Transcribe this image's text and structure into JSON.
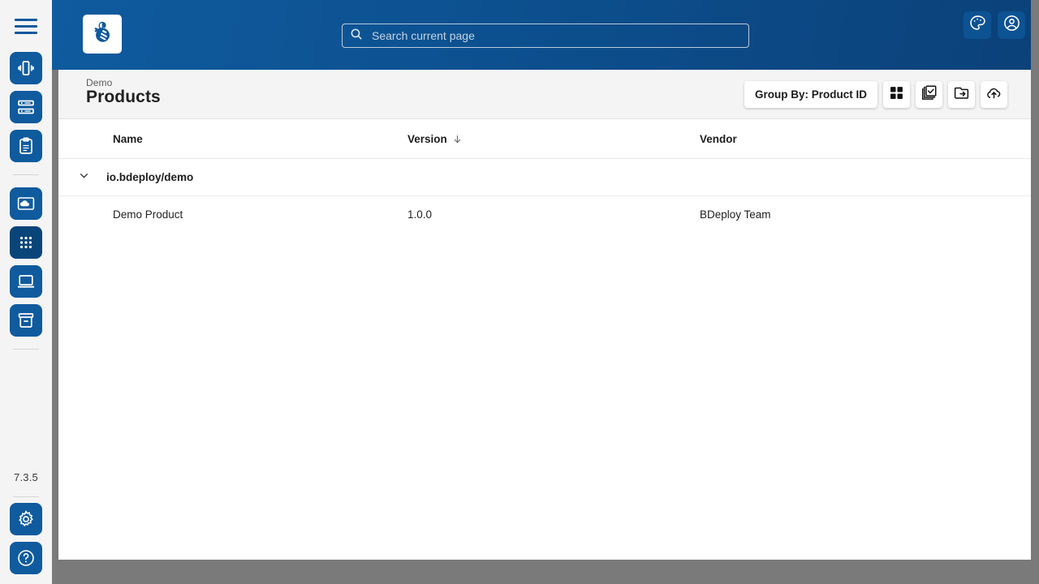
{
  "app": {
    "version": "7.3.5",
    "logo_icon": "bdeploy-bee-logo"
  },
  "menu": {
    "hamburger_icon": "hamburger-menu-icon"
  },
  "search": {
    "icon": "search-icon",
    "value": "",
    "placeholder": "Search current page"
  },
  "top_actions": [
    {
      "name": "theme-button",
      "icon": "palette-icon"
    },
    {
      "name": "account-button",
      "icon": "account-circle-icon"
    }
  ],
  "sidebar": {
    "items": [
      {
        "name": "instance-groups",
        "icon": "instances-icon",
        "active": false
      },
      {
        "name": "instances",
        "icon": "list-icon",
        "active": false
      },
      {
        "name": "reports",
        "icon": "clipboard-icon",
        "active": false
      },
      {
        "name": "software-repositories",
        "icon": "cloud-image-icon",
        "active": false
      },
      {
        "name": "products",
        "icon": "apps-grid-icon",
        "active": true
      },
      {
        "name": "client-applications",
        "icon": "laptop-icon",
        "active": false
      },
      {
        "name": "system-templates",
        "icon": "archive-icon",
        "active": false
      }
    ],
    "bottom_items": [
      {
        "name": "settings",
        "icon": "gear-icon"
      },
      {
        "name": "help",
        "icon": "help-circle-icon"
      }
    ]
  },
  "page": {
    "breadcrumb": "Demo",
    "title": "Products"
  },
  "toolbar": {
    "group_by_label": "Group By: Product ID",
    "buttons": [
      {
        "name": "grid-view-button",
        "icon": "grid-view-icon"
      },
      {
        "name": "bulk-manipulation-button",
        "icon": "library-add-check-icon"
      },
      {
        "name": "import-product-button",
        "icon": "folder-move-icon"
      },
      {
        "name": "upload-product-button",
        "icon": "cloud-upload-icon"
      }
    ]
  },
  "table": {
    "columns": [
      {
        "label": "Name",
        "sorted": false
      },
      {
        "label": "Version",
        "sorted": true,
        "sort_icon": "arrow-downward-icon"
      },
      {
        "label": "Vendor",
        "sorted": false
      }
    ],
    "groups": [
      {
        "label": "io.bdeploy/demo",
        "expanded": true,
        "expand_icon": "chevron-down-icon",
        "rows": [
          {
            "name": "Demo Product",
            "version": "1.0.0",
            "vendor": "BDeploy Team"
          }
        ]
      }
    ]
  },
  "colors": {
    "brand_blue": "#0f5b9e",
    "header_blue_dark": "#0b4179",
    "rail_bg": "#f4f4f4",
    "page_head_bg": "#f4f4f4",
    "outer_gray": "#7a7a7a"
  }
}
